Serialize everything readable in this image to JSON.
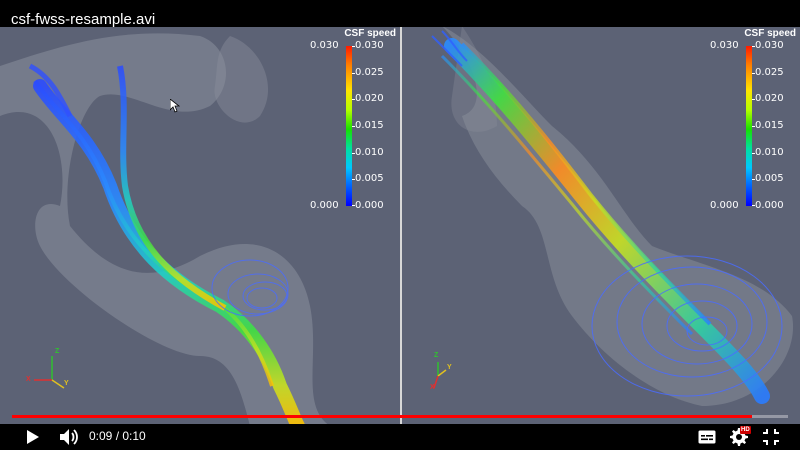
{
  "video": {
    "title": "csf-fwss-resample.avi",
    "current_time": "0:09",
    "duration": "0:10",
    "time_separator": " / ",
    "progress": 0.954
  },
  "colorbar": {
    "title": "CSF speed",
    "left_labels": [
      "0.030",
      "0.000"
    ],
    "right_labels": [
      "0.030",
      "0.025",
      "0.020",
      "0.015",
      "0.010",
      "0.005",
      "0.000"
    ]
  },
  "axes": {
    "x": "X",
    "y": "Y",
    "z": "Z"
  },
  "colors": {
    "progress": "#ff0000",
    "background": "#5c6275",
    "hd_badge": "#cc0000"
  },
  "icons": [
    "play-icon",
    "volume-icon",
    "subtitles-icon",
    "settings-icon",
    "hd-badge",
    "exit-fullscreen-icon"
  ],
  "controls": {
    "hd_badge": "HD"
  }
}
